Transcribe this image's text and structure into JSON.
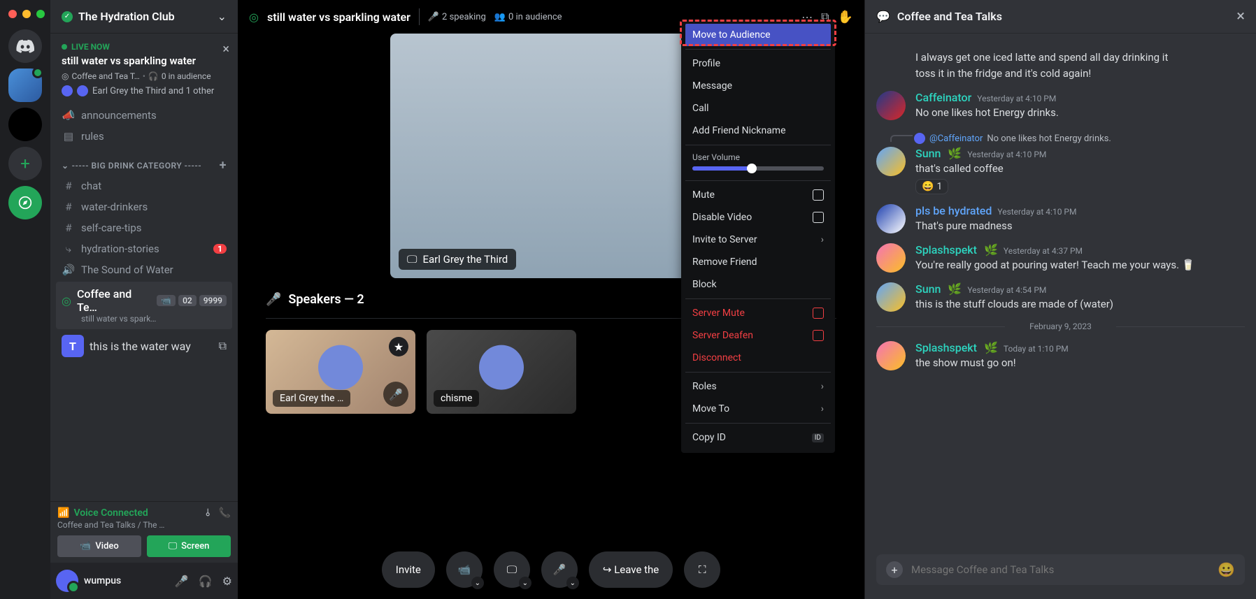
{
  "server": {
    "name": "The Hydration Club"
  },
  "live": {
    "badge": "LIVE NOW",
    "title": "still water vs sparkling water",
    "channel": "Coffee and Tea T…",
    "audience": "0 in audience",
    "speakers_line": "Earl Grey the Third and 1 other"
  },
  "channels": {
    "announcements": "announcements",
    "rules": "rules",
    "category": "----- BIG DRINK CATEGORY -----",
    "chat": "chat",
    "water_drinkers": "water-drinkers",
    "self_care": "self-care-tips",
    "hydration_stories": "hydration-stories",
    "hydration_badge": "1",
    "sound_of_water": "The Sound of Water",
    "coffee_tea": "Coffee and Te…",
    "coffee_tea_sub": "still water vs spark…",
    "coffee_tea_c1": "02",
    "coffee_tea_c2": "9999",
    "water_way": "this is the water way"
  },
  "voice_status": {
    "connected": "Voice Connected",
    "path": "Coffee and Tea Talks / The …",
    "video": "Video",
    "screen": "Screen"
  },
  "user_panel": {
    "name": "wumpus"
  },
  "stage": {
    "title": "still water vs sparkling water",
    "speaking": "2 speaking",
    "audience": "0 in audience",
    "video_label": "Earl Grey the Third",
    "speakers_header": "Speakers — 2",
    "speaker1": "Earl Grey the …",
    "speaker2": "chisme",
    "invite": "Invite",
    "leave": "Leave the"
  },
  "context_menu": {
    "move_audience": "Move to Audience",
    "profile": "Profile",
    "message": "Message",
    "call": "Call",
    "nickname": "Add Friend Nickname",
    "user_volume": "User Volume",
    "mute": "Mute",
    "disable_video": "Disable Video",
    "invite_server": "Invite to Server",
    "remove_friend": "Remove Friend",
    "block": "Block",
    "server_mute": "Server Mute",
    "server_deafen": "Server Deafen",
    "disconnect": "Disconnect",
    "roles": "Roles",
    "move_to": "Move To",
    "copy_id": "Copy ID"
  },
  "chat": {
    "title": "Coffee and Tea Talks",
    "placeholder": "Message Coffee and Tea Talks",
    "date_divider": "February 9, 2023",
    "messages": {
      "partial1": "I always get one iced latte and spend all day drinking it",
      "partial2": "toss it in the fridge and it's cold again!",
      "m1_user": "Caffeinator",
      "m1_ts": "Yesterday at 4:10 PM",
      "m1_text": "No one likes hot Energy drinks.",
      "reply_user": "@Caffeinator",
      "reply_text": "No one likes hot Energy drinks.",
      "m2_user": "Sunn",
      "m2_ts": "Yesterday at 4:10 PM",
      "m2_text": "that's called coffee",
      "m2_react": "😄",
      "m2_react_n": "1",
      "m3_user": "pls be hydrated",
      "m3_ts": "Yesterday at 4:10 PM",
      "m3_text": "That's pure madness",
      "m4_user": "Splashspekt",
      "m4_ts": "Yesterday at 4:37 PM",
      "m4_text": "You're really good at pouring water! Teach me your ways. 🥛",
      "m5_user": "Sunn",
      "m5_ts": "Yesterday at 4:54 PM",
      "m5_text": "this is the stuff clouds are made of (water)",
      "m6_user": "Splashspekt",
      "m6_ts": "Today at 1:10 PM",
      "m6_text": "the show must go on!"
    }
  }
}
